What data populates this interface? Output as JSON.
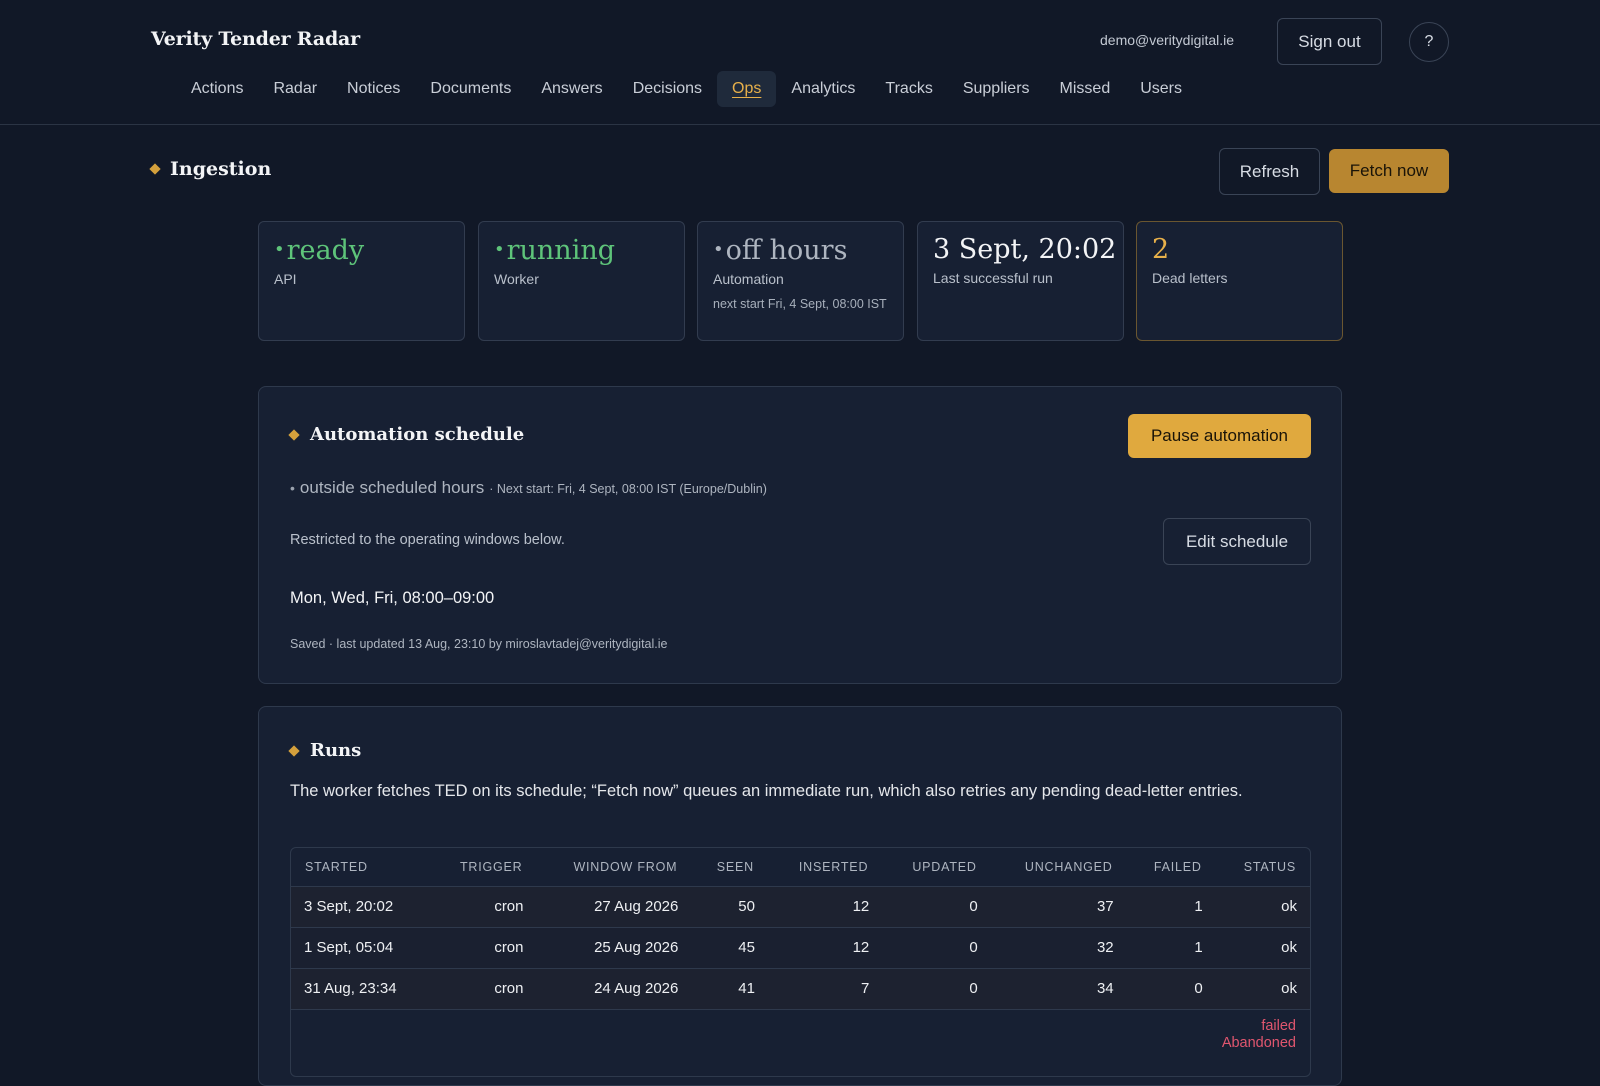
{
  "app": {
    "title": "Verity Tender Radar",
    "user_email": "demo@veritydigital.ie",
    "sign_out_label": "Sign out",
    "help_label": "?"
  },
  "nav": {
    "items": [
      {
        "label": "Actions",
        "active": false
      },
      {
        "label": "Radar",
        "active": false
      },
      {
        "label": "Notices",
        "active": false
      },
      {
        "label": "Documents",
        "active": false
      },
      {
        "label": "Answers",
        "active": false
      },
      {
        "label": "Decisions",
        "active": false
      },
      {
        "label": "Ops",
        "active": true
      },
      {
        "label": "Analytics",
        "active": false
      },
      {
        "label": "Tracks",
        "active": false
      },
      {
        "label": "Suppliers",
        "active": false
      },
      {
        "label": "Missed",
        "active": false
      },
      {
        "label": "Users",
        "active": false
      }
    ]
  },
  "ingestion": {
    "title": "Ingestion",
    "refresh_label": "Refresh",
    "fetch_label": "Fetch now",
    "cards": [
      {
        "dot": "•",
        "value": "ready",
        "label": "API",
        "sub": "",
        "tone": "green"
      },
      {
        "dot": "•",
        "value": "running",
        "label": "Worker",
        "sub": "",
        "tone": "green"
      },
      {
        "dot": "•",
        "value": "off hours",
        "label": "Automation",
        "sub": "next start Fri, 4 Sept, 08:00 IST",
        "tone": "grey"
      },
      {
        "dot": "",
        "value": "3 Sept, 20:02",
        "label": "Last successful run",
        "sub": "",
        "tone": "white"
      },
      {
        "dot": "",
        "value": "2",
        "label": "Dead letters",
        "sub": "",
        "tone": "amber"
      }
    ]
  },
  "schedule": {
    "title": "Automation schedule",
    "pause_label": "Pause automation",
    "state_dot": "•",
    "state": "outside scheduled hours",
    "next_start": "· Next start: Fri, 4 Sept, 08:00 IST (Europe/Dublin)",
    "restrict_note": "Restricted to the operating windows below.",
    "edit_label": "Edit schedule",
    "window": "Mon, Wed, Fri, 08:00–09:00",
    "saved_line": "Saved · last updated 13 Aug, 23:10 by miroslavtadej@veritydigital.ie"
  },
  "runs": {
    "title": "Runs",
    "description": "The worker fetches TED on its schedule; “Fetch now” queues an immediate run, which also retries any pending dead-letter entries.",
    "columns": [
      "STARTED",
      "TRIGGER",
      "WINDOW FROM",
      "SEEN",
      "INSERTED",
      "UPDATED",
      "UNCHANGED",
      "FAILED",
      "STATUS"
    ],
    "rows": [
      [
        "3 Sept, 20:02",
        "cron",
        "27 Aug 2026",
        "50",
        "12",
        "0",
        "37",
        "1",
        "ok"
      ],
      [
        "1 Sept, 05:04",
        "cron",
        "25 Aug 2026",
        "45",
        "12",
        "0",
        "32",
        "1",
        "ok"
      ],
      [
        "31 Aug, 23:34",
        "cron",
        "24 Aug 2026",
        "41",
        "7",
        "0",
        "34",
        "0",
        "ok"
      ]
    ],
    "partial_row_status": [
      "failed",
      "Abandoned"
    ],
    "colors": {
      "failed": "#e0566f"
    }
  },
  "colors": {
    "background": "#111827",
    "accent": "#e0a93e",
    "ok_green": "#5ec47a"
  }
}
